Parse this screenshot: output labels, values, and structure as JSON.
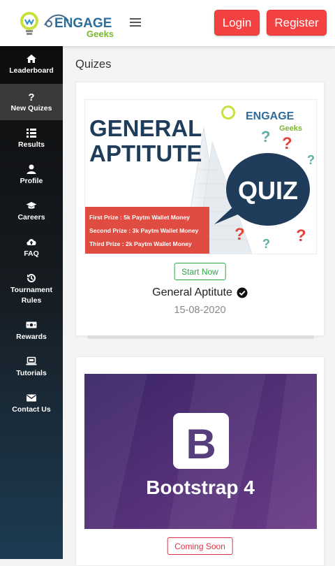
{
  "header": {
    "logo_brand": "ENGAGE",
    "logo_sub": "Geeks",
    "login_label": "Login",
    "register_label": "Register"
  },
  "sidebar": {
    "items": [
      {
        "label": "Leaderboard",
        "icon": "home-icon"
      },
      {
        "label": "New Quizes",
        "icon": "question-icon",
        "active": true
      },
      {
        "label": "Results",
        "icon": "list-icon"
      },
      {
        "label": "Profile",
        "icon": "user-icon"
      },
      {
        "label": "Careers",
        "icon": "graduation-cap-icon"
      },
      {
        "label": "FAQ",
        "icon": "cloud-upload-icon"
      },
      {
        "label": "Tournament Rules",
        "icon": "history-icon"
      },
      {
        "label": "Rewards",
        "icon": "money-icon"
      },
      {
        "label": "Tutorials",
        "icon": "laptop-icon"
      },
      {
        "label": "Contact Us",
        "icon": "envelope-icon"
      }
    ]
  },
  "main": {
    "heading": "Quizes",
    "quizzes": [
      {
        "banner": {
          "line1": "GENERAL",
          "line2": "APTITUTE",
          "bubble": "QUIZ",
          "prizes": [
            "First Prize : 5k Paytm Wallet Money",
            "Second Prize : 3k Paytm Wallet Money",
            "Third Prize : 2k Paytm Wallet Money"
          ]
        },
        "button_label": "Start Now",
        "title": "General Aptitute",
        "date": "15-08-2020"
      },
      {
        "banner": {
          "letter": "B",
          "text": "Bootstrap 4"
        },
        "button_label": "Coming Soon"
      }
    ]
  },
  "colors": {
    "brand_red": "#f44242",
    "sidebar_dark": "#0d0d0d",
    "sidebar_blue": "#1d3b52",
    "start_green": "#28a745",
    "soon_red": "#dc3545",
    "banner_navy": "#1f3c5a",
    "bootstrap_purple": "#563d7c"
  }
}
